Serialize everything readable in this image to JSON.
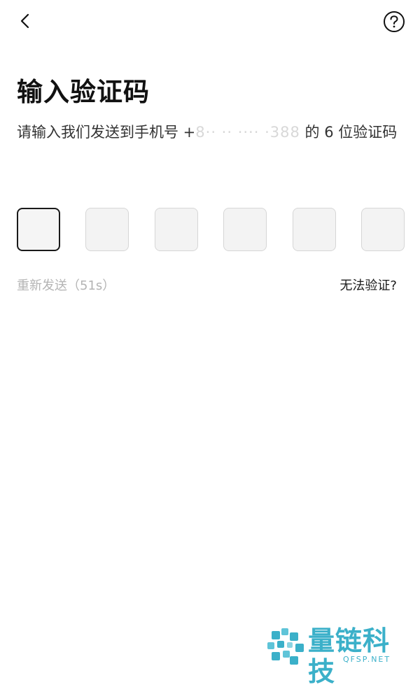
{
  "header": {
    "back_icon": "chevron-left-icon",
    "help_icon": "question-circle-icon"
  },
  "main": {
    "title": "输入验证码",
    "subtitle_prefix": "请输入我们发送到手机号 +",
    "phone_masked": "8·· ·· ···· ·388",
    "subtitle_suffix": "的 6 位验证码",
    "code_boxes": [
      "",
      "",
      "",
      "",
      "",
      ""
    ],
    "resend_text": "重新发送（51s）",
    "cannot_verify_text": "无法验证?"
  },
  "watermark": {
    "name": "量链科技",
    "domain": "QFSP.NET",
    "color": "#3bb0c9"
  }
}
